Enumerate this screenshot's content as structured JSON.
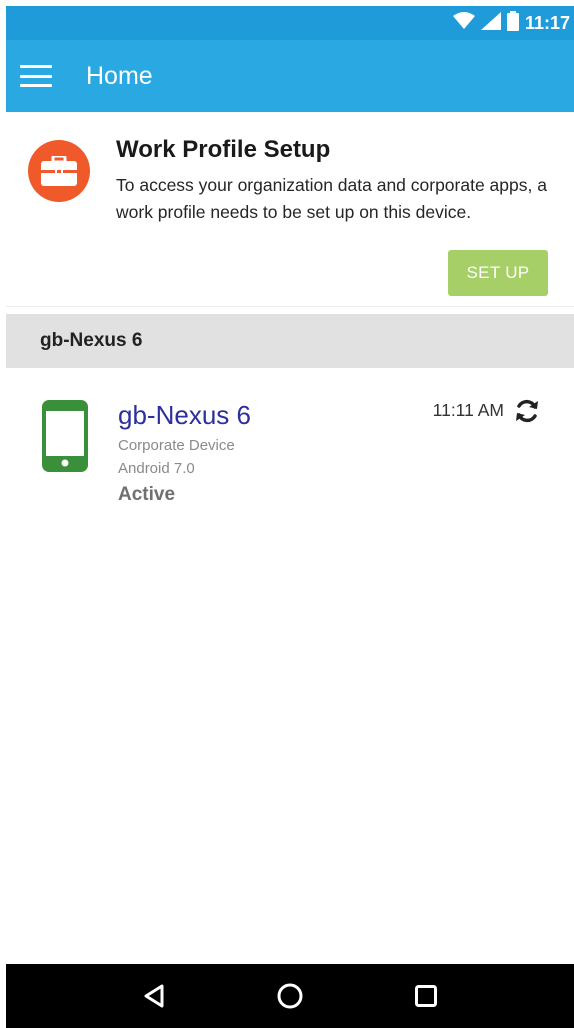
{
  "status_bar": {
    "time": "11:17",
    "icons": [
      "wifi-icon",
      "signal-icon",
      "battery-icon"
    ]
  },
  "app_bar": {
    "title": "Home",
    "menu_icon": "menu-icon"
  },
  "setup_card": {
    "icon": "briefcase-icon",
    "title": "Work Profile Setup",
    "description": "To access your organization data and corporate apps, a work profile needs to be set up on this device.",
    "button_label": "SET UP"
  },
  "section": {
    "header": "gb-Nexus 6"
  },
  "device": {
    "icon": "phone-icon",
    "name": "gb-Nexus 6",
    "type": "Corporate Device",
    "os": "Android 7.0",
    "status": "Active",
    "last_sync": "11:11 AM",
    "sync_icon": "sync-icon"
  },
  "nav_bar": {
    "buttons": [
      "back-icon",
      "home-icon",
      "recents-icon"
    ]
  },
  "colors": {
    "status_bar": "#1f9bd9",
    "app_bar": "#29a8e1",
    "briefcase_bg": "#f05a2a",
    "setup_button": "#a7cf68",
    "section_header_bg": "#e1e1e1",
    "device_name": "#2c2f9c",
    "phone_icon": "#3a8f3a"
  }
}
